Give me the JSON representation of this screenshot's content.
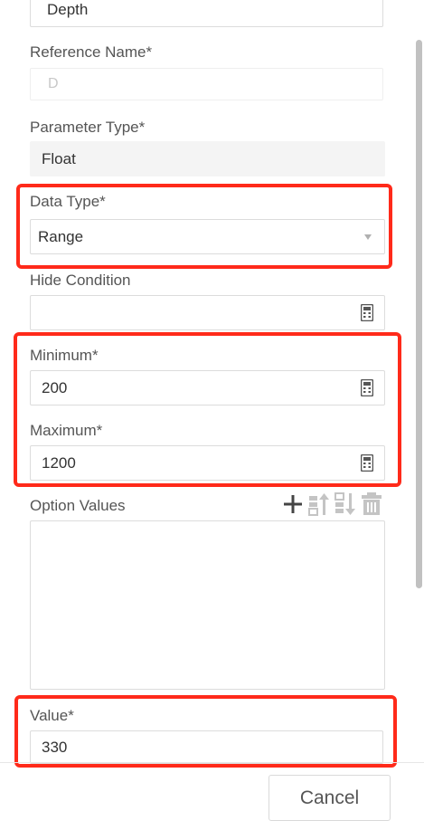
{
  "form": {
    "name_value": "Depth",
    "reference_name_label": "Reference Name*",
    "reference_name_placeholder": "D",
    "parameter_type_label": "Parameter Type*",
    "parameter_type_value": "Float",
    "data_type_label": "Data Type*",
    "data_type_value": "Range",
    "hide_condition_label": "Hide Condition",
    "hide_condition_value": "",
    "minimum_label": "Minimum*",
    "minimum_value": "200",
    "maximum_label": "Maximum*",
    "maximum_value": "1200",
    "option_values_label": "Option Values",
    "value_label": "Value*",
    "value_value": "330"
  },
  "toolbar": {
    "icons": [
      "plus-icon",
      "move-up-icon",
      "move-down-icon",
      "delete-icon"
    ]
  },
  "footer": {
    "cancel_label": "Cancel"
  },
  "colors": {
    "highlight": "#ff2a1a",
    "disabled_bg": "#f4f4f4",
    "border": "#dcdcdc"
  }
}
